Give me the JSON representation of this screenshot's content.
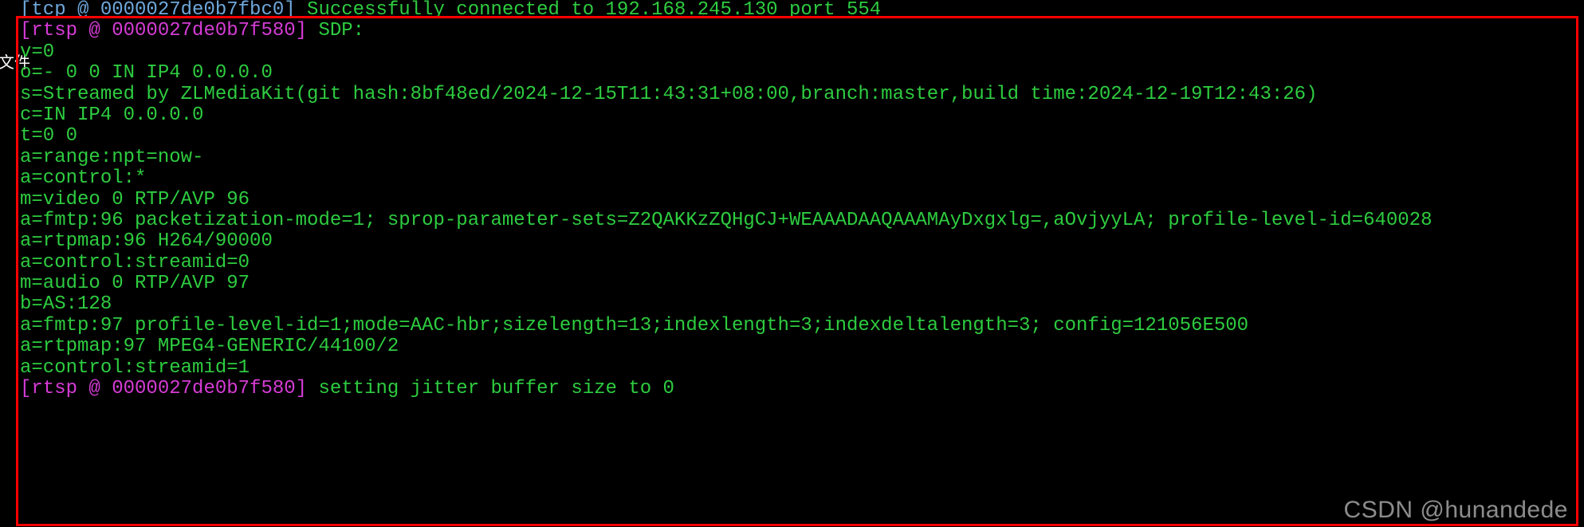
{
  "sidebar": {
    "label": "文件"
  },
  "terminal": {
    "line0_prefix": "[tcp @ 0000027de0b7fbc0]",
    "line0_msg": " Successfully connected to 192.168.245.130 port 554",
    "line1_prefix": "[rtsp @ 0000027de0b7f580]",
    "line1_msg": " SDP:",
    "line2": "v=0",
    "line3": "o=- 0 0 IN IP4 0.0.0.0",
    "line4": "s=Streamed by ZLMediaKit(git hash:8bf48ed/2024-12-15T11:43:31+08:00,branch:master,build time:2024-12-19T12:43:26)",
    "line5": "c=IN IP4 0.0.0.0",
    "line6": "t=0 0",
    "line7": "a=range:npt=now-",
    "line8": "a=control:*",
    "line9": "m=video 0 RTP/AVP 96",
    "line10": "a=fmtp:96 packetization-mode=1; sprop-parameter-sets=Z2QAKKzZQHgCJ+WEAAADAAQAAAMAyDxgxlg=,aOvjyyLA; profile-level-id=640028",
    "line11": "a=rtpmap:96 H264/90000",
    "line12": "a=control:streamid=0",
    "line13": "m=audio 0 RTP/AVP 97",
    "line14": "b=AS:128",
    "line15": "a=fmtp:97 profile-level-id=1;mode=AAC-hbr;sizelength=13;indexlength=3;indexdeltalength=3; config=121056E500",
    "line16": "a=rtpmap:97 MPEG4-GENERIC/44100/2",
    "line17": "a=control:streamid=1",
    "line18": "",
    "line19_prefix": "[rtsp @ 0000027de0b7f580]",
    "line19_msg": " setting jitter buffer size to 0"
  },
  "watermark": "CSDN @hunandede"
}
